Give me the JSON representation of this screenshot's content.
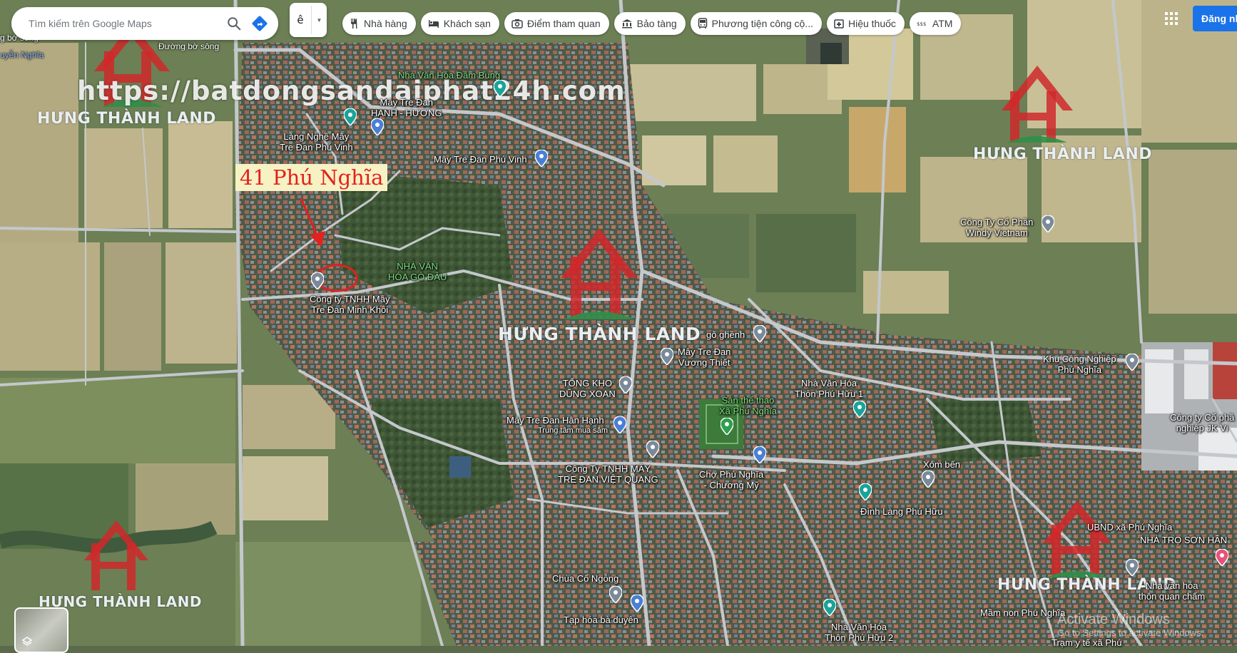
{
  "search": {
    "placeholder": "Tìm kiếm trên Google Maps",
    "search_icon": "search-icon",
    "directions_icon": "directions-icon"
  },
  "layer_select": {
    "value": "ê"
  },
  "chips": [
    {
      "label": "Nhà hàng",
      "icon": "restaurant-icon"
    },
    {
      "label": "Khách sạn",
      "icon": "hotel-icon"
    },
    {
      "label": "Điểm tham quan",
      "icon": "camera-icon"
    },
    {
      "label": "Bảo tàng",
      "icon": "museum-icon"
    },
    {
      "label": "Phương tiện công cộ...",
      "icon": "transit-icon"
    },
    {
      "label": "Hiệu thuốc",
      "icon": "pharmacy-icon"
    },
    {
      "label": "ATM",
      "icon": "atm-icon"
    }
  ],
  "header": {
    "signin": "Đăng nh",
    "apps_icon": "apps-grid-icon"
  },
  "watermark": {
    "url": "https://batdongsandaiphat24h.com",
    "brand": "HƯNG THÀNH LAND",
    "logo_letters": "HT",
    "logo_color": "#d0282a"
  },
  "callout": {
    "label": "41 Phú Nghĩa",
    "color": "#e3211f"
  },
  "roads": {
    "duong_bo_song": "Đường bờ sông",
    "left_edge_1": "g bờ sông",
    "left_edge_2": "uyễn Nghĩa"
  },
  "pois": {
    "nvh_dam_bung": "Nhà Văn Hóa Đầm Bung",
    "may_tre_dan_hanh_huong": "Mây Tre Đan\nHẠNH - HƯƠNG",
    "lang_nghe": "Làng Nghề Mây\nTre Đan Phú Vinh",
    "may_tre_phu_vinh": "Mây Tre Đan Phú Vinh",
    "nvh_go_dau": "NHÀ VĂN\nHÓA GÒ ĐẬU",
    "minh_khoi": "Công ty TNHH Mây\nTre Đan Minh Khôi",
    "go_ghenh": "gò ghềnh",
    "vuong_thiet": "Mây Tre Đan\nVương Thiết",
    "tong_kho": "TỔNG KHO\nDŨNG XOAN",
    "nvh_phu_huu_1": "Nhà Văn Hóa\nThôn Phú Hữu 1",
    "san_the_thao": "Sân thể thao\nXã Phú Nghĩa",
    "han_hanh": "Mây Tre Đan Hân Hạnh",
    "han_hanh_sub": "Trung tâm mua sắm",
    "viet_quang": "Công Ty TNHH MÂY\nTRE ĐAN VIỆT QUANG",
    "cho_phu_nghia": "Chợ Phú Nghĩa\n- Chương Mỹ",
    "xom_ben": "Xóm bến",
    "dinh_lang": "Đình Làng Phú Hữu",
    "ubnd": "UBND xã Phú Nghĩa",
    "nha_tro": "NHÀ TRỌ SƠN HÂN",
    "khu_cn": "Khu Công Nghiệp\nPhú Nghĩa",
    "cty_right": "Công ty Cổ phầ\nnghiệp JK Vi",
    "windy": "Công Ty Cổ Phần\nWindy Vietnam",
    "chua_co_ngong": "Chùa Cổ Ngỗng",
    "tap_hoa": "Tạp hóa bà duyên",
    "nvh_phu_huu_2": "Nhà Văn Hóa\nThôn Phú Hữu 2",
    "mam_non": "Mầm non Phú Nghĩa",
    "nvh_quan_cham": "Nhà văn hóa\nthôn quan chấm",
    "tram_y_te": "Trạm y tế xã Phú"
  },
  "activate": {
    "title": "Activate Windows",
    "sub": "Go to Settings to activate Windows."
  },
  "colors": {
    "road": "#c4c8cc",
    "road_major": "#d8dadc",
    "field_light": "#b9ad82",
    "field_green": "#6f8a55",
    "village": "#4a5a42",
    "pin_blue": "#4a7fd6",
    "pin_teal": "#1aa39a",
    "chip_bg": "#ffffff",
    "signin_bg": "#1a73e8"
  }
}
